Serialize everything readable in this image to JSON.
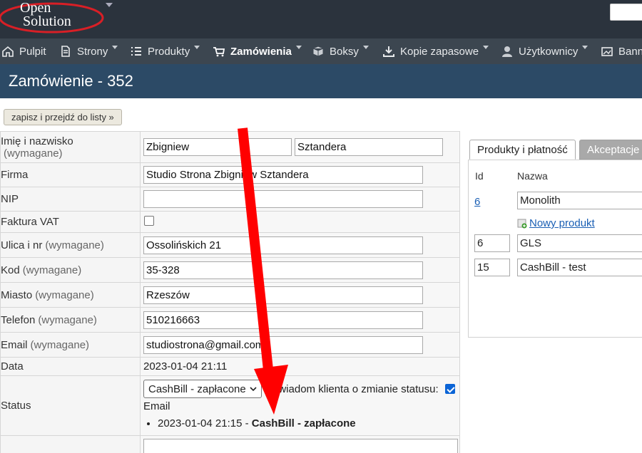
{
  "logo": {
    "line1": "Open",
    "line2": "Solution"
  },
  "nav": [
    {
      "label": "Pulpit",
      "icon": "home-icon"
    },
    {
      "label": "Strony",
      "icon": "document-icon"
    },
    {
      "label": "Produkty",
      "icon": "list-icon"
    },
    {
      "label": "Zamówienia",
      "icon": "cart-icon"
    },
    {
      "label": "Boksy",
      "icon": "box-icon"
    },
    {
      "label": "Kopie zapasowe",
      "icon": "download-icon"
    },
    {
      "label": "Użytkownicy",
      "icon": "user-icon"
    },
    {
      "label": "Bann",
      "icon": "banner-icon"
    }
  ],
  "page_title": "Zamówienie - 352",
  "save_button": "zapisz i przejdź do listy »",
  "required_label": "(wymagane)",
  "form": {
    "name_label": "Imię i nazwisko",
    "first_name": "Zbigniew",
    "last_name": "Sztandera",
    "company_label": "Firma",
    "company": "Studio Strona Zbigniew Sztandera",
    "nip_label": "NIP",
    "nip": "",
    "vat_label": "Faktura VAT",
    "street_label": "Ulica i nr",
    "street": "Ossolińskich 21",
    "zip_label": "Kod",
    "zip": "35-328",
    "city_label": "Miasto",
    "city": "Rzeszów",
    "phone_label": "Telefon",
    "phone": "510216663",
    "email_label": "Email",
    "email": "studiostrona@gmail.com",
    "date_label": "Data",
    "date": "2023-01-04 21:11",
    "status_label": "Status",
    "status_value": "CashBill - zapłacone",
    "notify_label": "Powiadom klienta o zmianie statusu:",
    "notify_email": "Email",
    "history_date": "2023-01-04 21:15 - ",
    "history_status": "CashBill - zapłacone"
  },
  "panel": {
    "tab_products": "Produkty i płatność",
    "tab_accept": "Akceptacje",
    "col_id": "Id",
    "col_name": "Nazwa",
    "row1_id": "6",
    "row1_name": "Monolith",
    "new_product": "Nowy produkt",
    "row2_id": "6",
    "row2_name": "GLS",
    "row3_id": "15",
    "row3_name": "CashBill - test"
  },
  "colors": {
    "topbar": "#2b333d",
    "nav": "#3c4650",
    "title": "#2c4a66",
    "arrow": "#ff0000"
  }
}
